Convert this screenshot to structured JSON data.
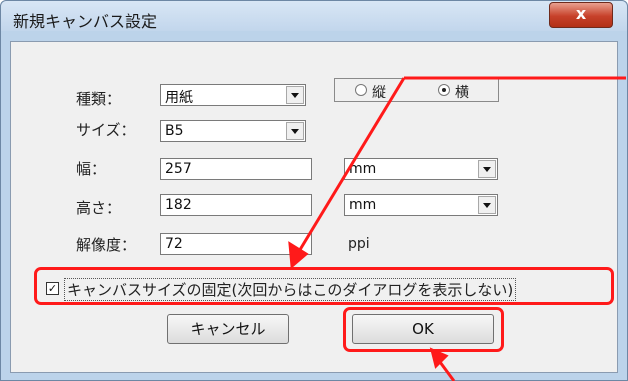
{
  "window": {
    "title": "新規キャンバス設定",
    "close_label": "x"
  },
  "form": {
    "type_label": "種類：",
    "type_value": "用紙",
    "size_label": "サイズ：",
    "size_value": "B5",
    "orientation": {
      "portrait": "縦",
      "landscape": "横",
      "selected": "landscape"
    },
    "width_label": "幅：",
    "width_value": "257",
    "width_unit": "mm",
    "height_label": "高さ：",
    "height_value": "182",
    "height_unit": "mm",
    "resolution_label": "解像度：",
    "resolution_value": "72",
    "resolution_unit": "ppi",
    "fix_size_label": "キャンバスサイズの固定(次回からはこのダイアログを表示しない)",
    "fix_size_checked": true
  },
  "buttons": {
    "cancel": "キャンセル",
    "ok": "OK"
  },
  "colors": {
    "annotation": "#ff1a1a"
  }
}
